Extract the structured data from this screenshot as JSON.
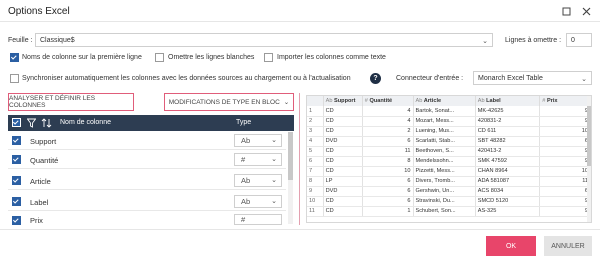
{
  "window": {
    "title": "Options Excel"
  },
  "sheet": {
    "label": "Feuille :",
    "value": "Classique$",
    "skip_label": "Lignes à omettre :",
    "skip_value": "0"
  },
  "options": [
    {
      "label": "Noms de colonne sur la première ligne",
      "checked": true
    },
    {
      "label": "Omettre les lignes blanches",
      "checked": false
    },
    {
      "label": "Importer les colonnes comme texte",
      "checked": false
    }
  ],
  "sync": {
    "label": "Synchroniser automatiquement les colonnes avec les données sources au chargement ou à l'actualisation",
    "checked": false
  },
  "connector": {
    "label": "Connecteur d'entrée :",
    "value": "Monarch Excel Table"
  },
  "buttons": {
    "analyze": "ANALYSER ET DÉFINIR LES COLONNES",
    "modify": "MODIFICATIONS DE TYPE EN BLOC",
    "ok": "OK",
    "cancel": "ANNULER"
  },
  "columns_panel": {
    "header_name": "Nom de colonne",
    "header_type": "Type",
    "rows": [
      {
        "name": "Support",
        "type": "Ab"
      },
      {
        "name": "Quantité",
        "type": "#"
      },
      {
        "name": "Article",
        "type": "Ab"
      },
      {
        "name": "Label",
        "type": "Ab"
      },
      {
        "name": "Prix",
        "type": "#"
      }
    ]
  },
  "preview": {
    "headers": [
      {
        "icon": "Ab",
        "name": "Support"
      },
      {
        "icon": "#",
        "name": "Quantité"
      },
      {
        "icon": "Ab",
        "name": "Article"
      },
      {
        "icon": "Ab",
        "name": "Label"
      },
      {
        "icon": "#",
        "name": "Prix"
      }
    ],
    "rows": [
      [
        "1",
        "CD",
        "4",
        "Bartok, Sonat...",
        "MK-42625",
        "9"
      ],
      [
        "2",
        "CD",
        "4",
        "Mozart, Mess...",
        "420831-2",
        "9"
      ],
      [
        "3",
        "CD",
        "2",
        "Luening, Mus...",
        "CD 611",
        "10"
      ],
      [
        "4",
        "DVD",
        "6",
        "Scarlatti, Stab...",
        "SBT 48282",
        "6"
      ],
      [
        "5",
        "CD",
        "11",
        "Beethoven, S...",
        "420413-2",
        "9"
      ],
      [
        "6",
        "CD",
        "8",
        "Mendelssohn...",
        "SMK 47592",
        "9"
      ],
      [
        "7",
        "CD",
        "10",
        "Pizzetti, Mess...",
        "CHAN 8964",
        "10"
      ],
      [
        "8",
        "LP",
        "6",
        "Divers, Tromb...",
        "ADA 581087",
        "11"
      ],
      [
        "9",
        "DVD",
        "6",
        "Gershwin, Un...",
        "ACS 8034",
        "6"
      ],
      [
        "10",
        "CD",
        "6",
        "Stravinski, Du...",
        "SMCD 5120",
        "9"
      ],
      [
        "11",
        "CD",
        "1",
        "Schubert, Son...",
        "AS-325",
        "9"
      ]
    ]
  }
}
